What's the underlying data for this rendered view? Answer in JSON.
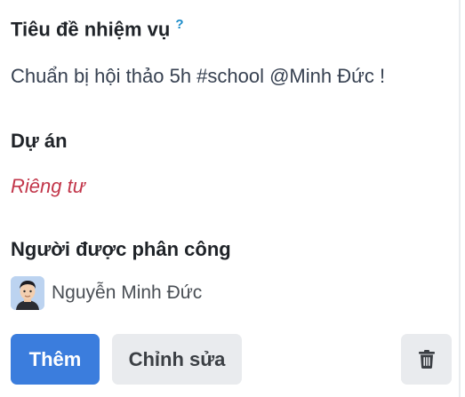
{
  "task": {
    "title_label": "Tiêu đề nhiệm vụ",
    "help_mark": "?",
    "title_value": "Chuẩn bị hội thảo 5h #school @Minh Đức !"
  },
  "project": {
    "label": "Dự án",
    "value": "Riêng tư"
  },
  "assignee": {
    "label": "Người được phân công",
    "name": "Nguyễn Minh Đức",
    "avatar_icon": "memoji-avatar"
  },
  "actions": {
    "add_label": "Thêm",
    "edit_label": "Chỉnh sửa",
    "delete_icon": "trash-icon"
  },
  "colors": {
    "primary": "#3b7ddd",
    "private_text": "#c2364a",
    "help_mark": "#1a8bc9",
    "secondary_button": "#e9ebee"
  }
}
